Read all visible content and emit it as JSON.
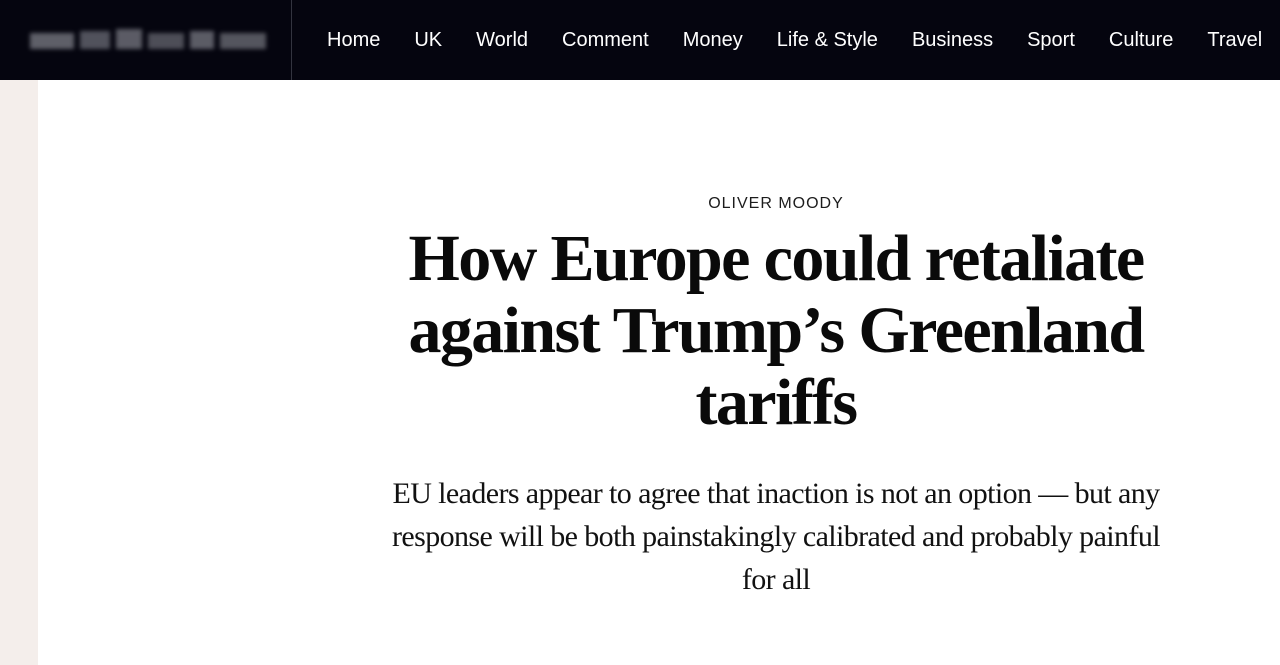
{
  "header": {
    "logo_text": "The Times",
    "nav": [
      {
        "label": "Home"
      },
      {
        "label": "UK"
      },
      {
        "label": "World"
      },
      {
        "label": "Comment"
      },
      {
        "label": "Money"
      },
      {
        "label": "Life & Style"
      },
      {
        "label": "Business"
      },
      {
        "label": "Sport"
      },
      {
        "label": "Culture"
      },
      {
        "label": "Travel"
      }
    ]
  },
  "article": {
    "byline": "OLIVER MOODY",
    "headline": "How Europe could retaliate against Trump’s Greenland tariffs",
    "standfirst": "EU leaders appear to agree that inaction is not an option — but any response will be both painstakingly calibrated and probably painful for all"
  },
  "colors": {
    "header_background": "#05050f",
    "side_strip": "#f4eeeb",
    "text": "#0a0a0a"
  }
}
